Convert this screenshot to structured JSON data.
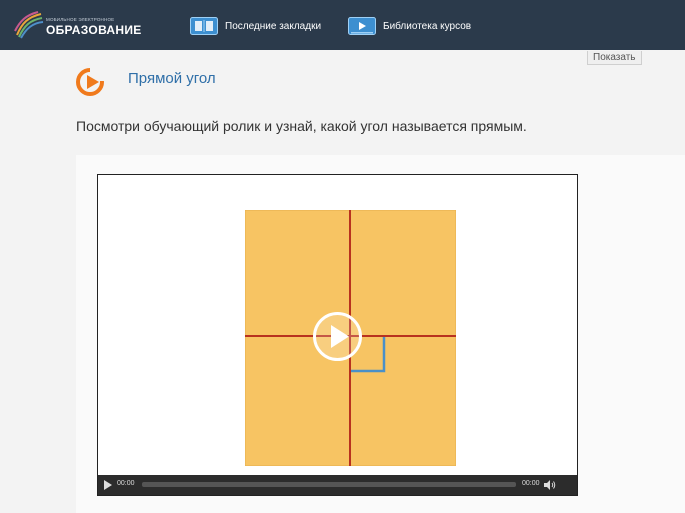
{
  "header": {
    "logo_small": "Мобильное электронное",
    "logo_big": "ОБРАЗОВАНИЕ",
    "nav": [
      {
        "label": "Последние закладки",
        "icon": "book-icon"
      },
      {
        "label": "Библиотека курсов",
        "icon": "video-library-icon"
      }
    ]
  },
  "toolbar": {
    "show_label": "Показать"
  },
  "lesson": {
    "icon": "lesson-play-icon",
    "title": "Прямой угол",
    "instruction": "Посмотри обучающий ролик и узнай, какой угол называется прямым."
  },
  "player": {
    "time_current": "00:00",
    "time_total": "00:00",
    "progress": 0,
    "colors": {
      "paper": "#f7c463",
      "fold_lines": "#b8321f",
      "right_angle_mark": "#4a90c8",
      "accent": "#f07a1c",
      "topbar": "#2b3a4b"
    }
  }
}
